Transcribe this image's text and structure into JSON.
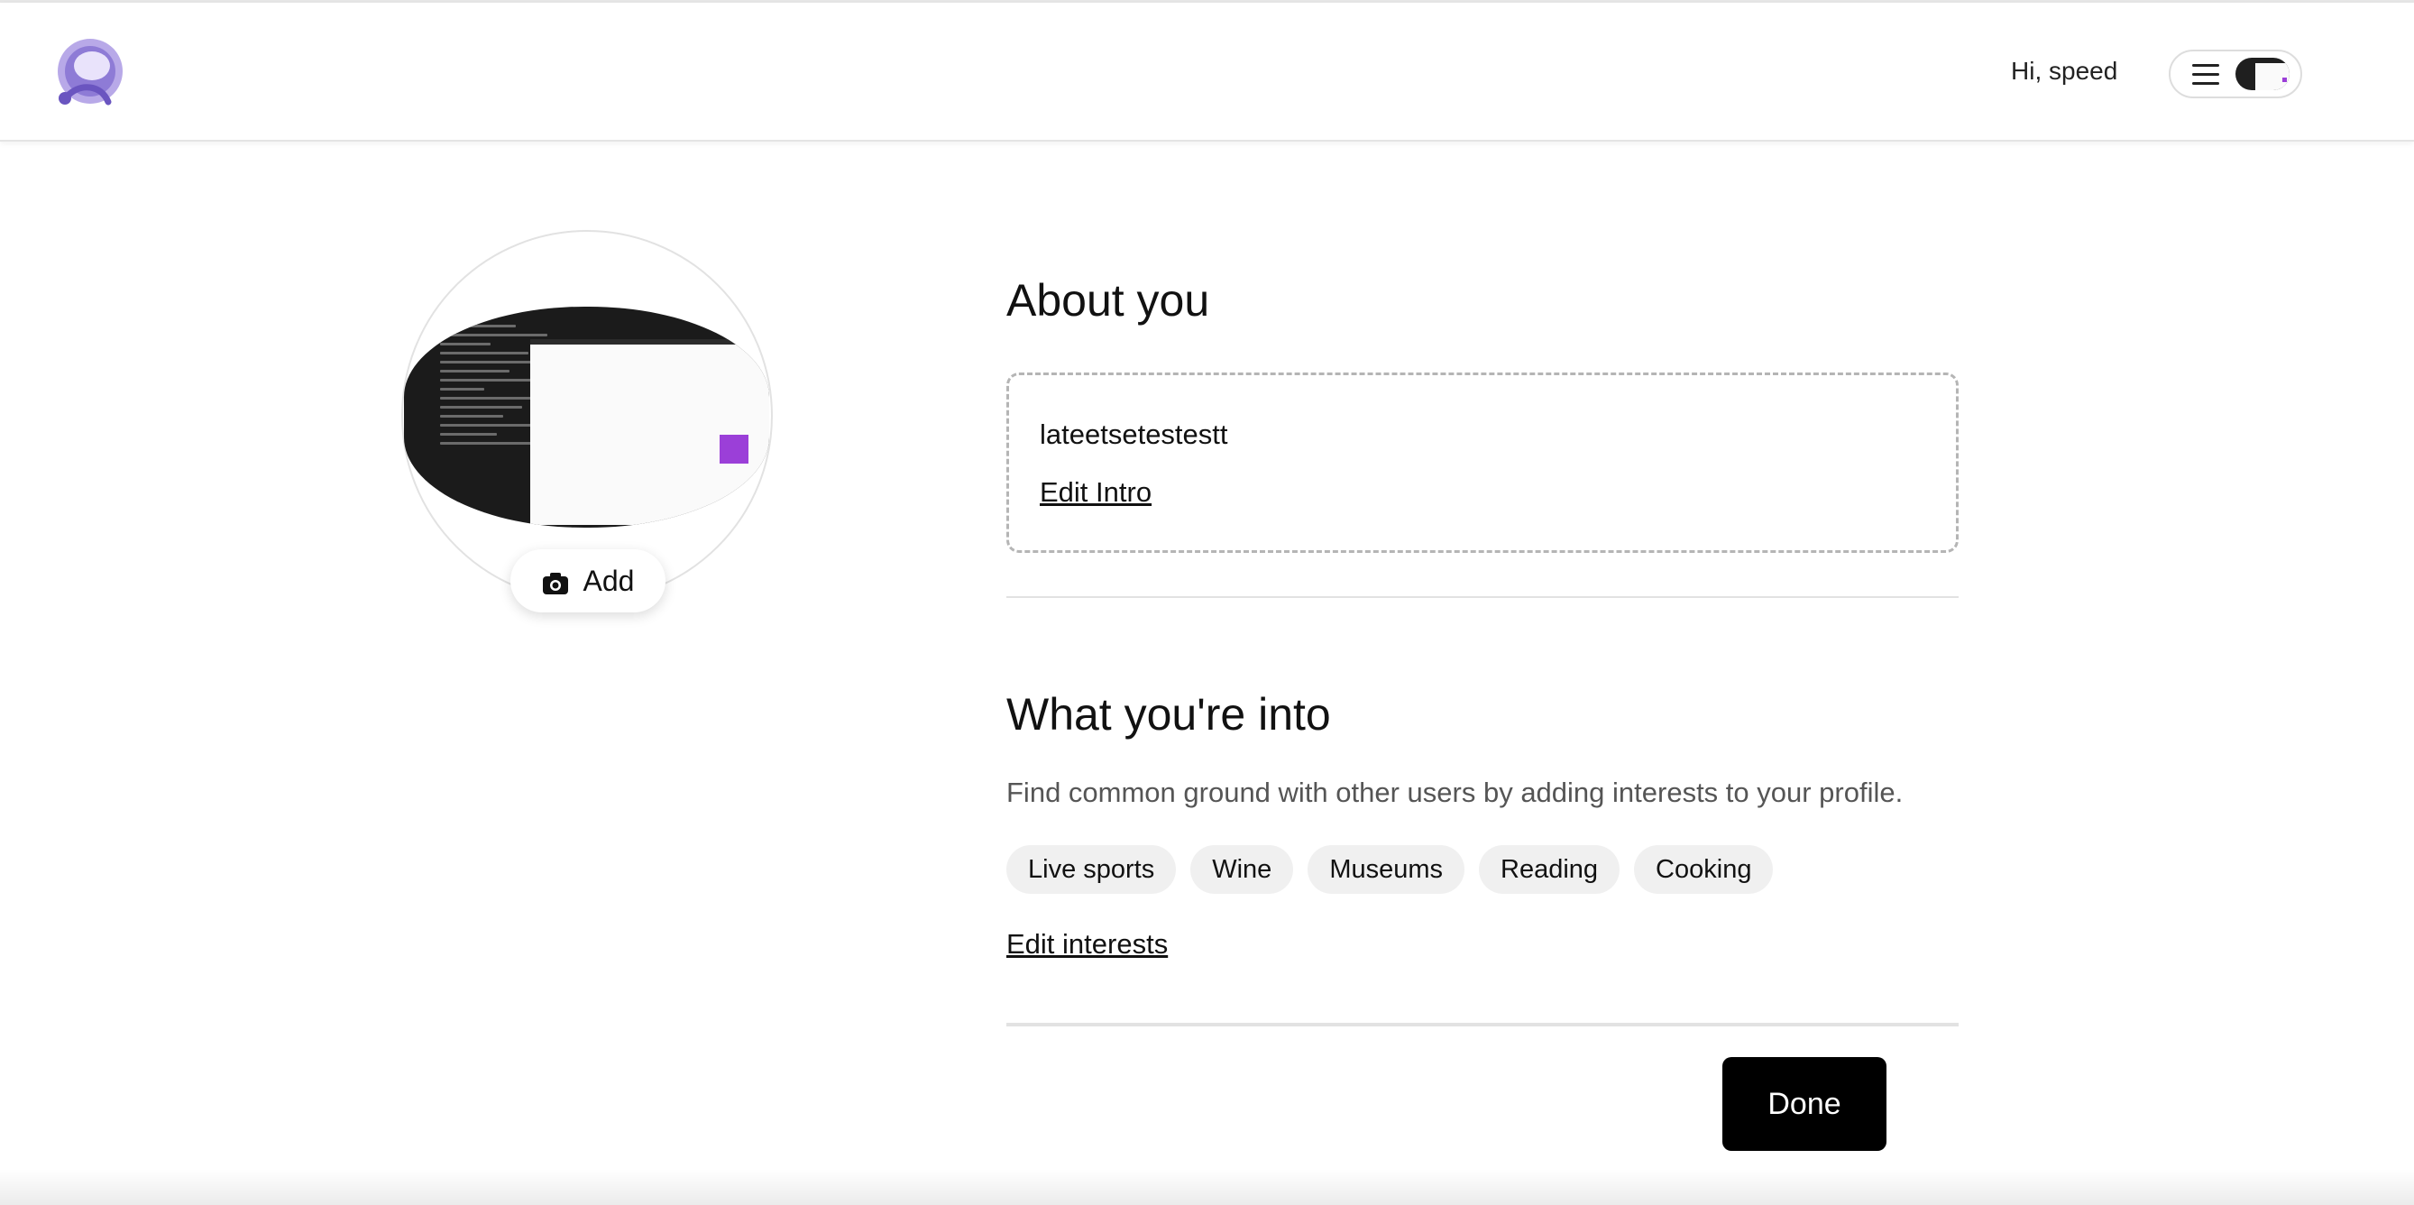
{
  "header": {
    "greeting": "Hi, speed",
    "logo_icon": "quora-style-logo-icon",
    "menu_icon": "hamburger-menu-icon"
  },
  "profile_photo": {
    "add_label": "Add",
    "add_icon": "camera-icon"
  },
  "about": {
    "title": "About you",
    "intro_text": "lateetsetestestt",
    "edit_link": "Edit Intro"
  },
  "interests": {
    "title": "What you're into",
    "subtitle": "Find common ground with other users by adding interests to your profile.",
    "items": [
      "Live sports",
      "Wine",
      "Museums",
      "Reading",
      "Cooking"
    ],
    "edit_link": "Edit interests"
  },
  "actions": {
    "done_label": "Done"
  },
  "colors": {
    "accent": "#9b3fd8",
    "primary_button": "#000000"
  }
}
